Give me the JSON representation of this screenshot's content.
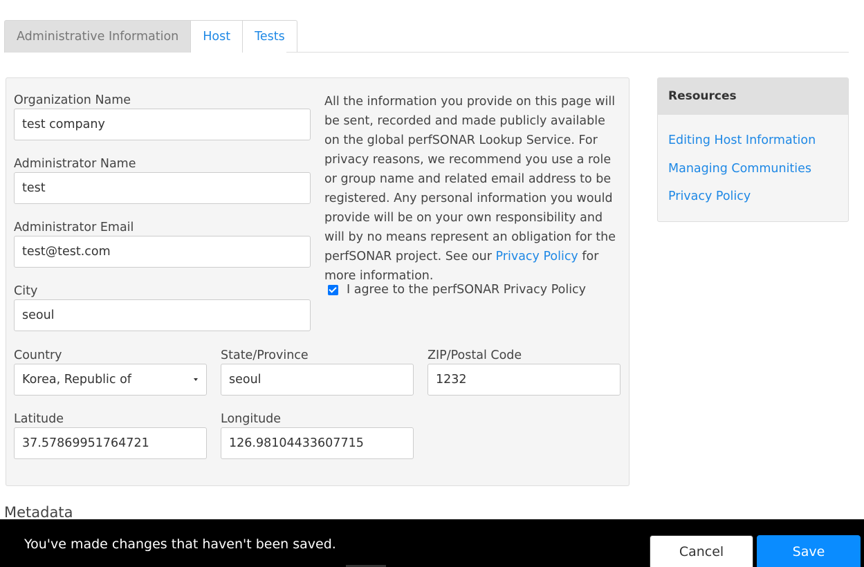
{
  "tabs": [
    {
      "label": "Administrative Information",
      "active": true
    },
    {
      "label": "Host",
      "active": false
    },
    {
      "label": "Tests",
      "active": false
    }
  ],
  "form": {
    "org_name_label": "Organization Name",
    "org_name_value": "test company",
    "admin_name_label": "Administrator Name",
    "admin_name_value": "test",
    "admin_email_label": "Administrator Email",
    "admin_email_value": "test@test.com",
    "city_label": "City",
    "city_value": "seoul",
    "country_label": "Country",
    "country_value": "Korea, Republic of",
    "state_label": "State/Province",
    "state_value": "seoul",
    "zip_label": "ZIP/Postal Code",
    "zip_value": "1232",
    "latitude_label": "Latitude",
    "latitude_value": "37.57869951764721",
    "longitude_label": "Longitude",
    "longitude_value": "126.98104433607715"
  },
  "info": {
    "text_before": "All the information you provide on this page will be sent, recorded and made publicly available on the global perfSONAR Lookup Service. For privacy reasons, we recommend you use a role or group name and related email address to be registered. Any personal information you would provide will be on your own responsibility and will by no means represent an obligation for the perfSONAR project. See our ",
    "link": "Privacy Policy",
    "text_after": " for more information.",
    "agree_label": "I agree to the perfSONAR Privacy Policy",
    "agree_checked": true
  },
  "resources": {
    "title": "Resources",
    "links": [
      "Editing Host Information",
      "Managing Communities",
      "Privacy Policy"
    ]
  },
  "metadata_heading": "Metadata",
  "unsaved": {
    "message": "You've made changes that haven't been saved.",
    "cancel_label": "Cancel",
    "save_label": "Save"
  },
  "colors": {
    "link": "#1e88e5",
    "save": "#0a8cff",
    "bar": "#000000"
  }
}
